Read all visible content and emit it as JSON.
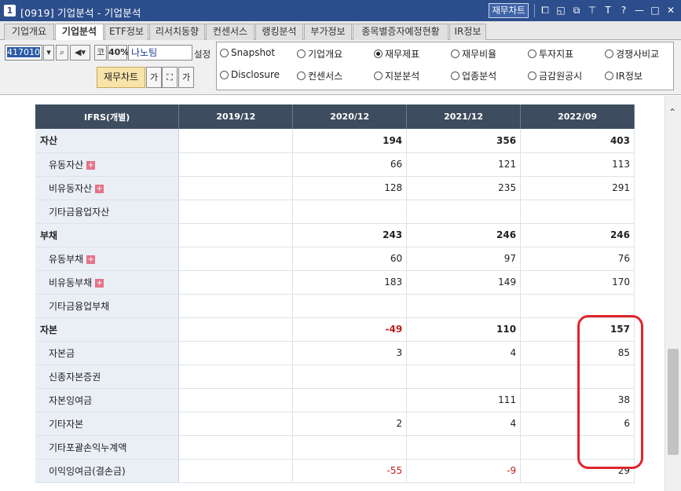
{
  "window": {
    "number": "1",
    "title": "[0919] 기업분석 - 기업분석",
    "financial_chart_button": "재무차트",
    "icons": [
      "chart-icon",
      "window-icon",
      "restore-icon",
      "pin-icon",
      "font-icon",
      "help-icon",
      "minimize-icon",
      "maximize-icon",
      "close-icon"
    ],
    "icon_glyphs": [
      "⧠",
      "◱",
      "⧉",
      "⊤",
      "T",
      "?",
      "—",
      "□",
      "✕"
    ]
  },
  "tabs": [
    {
      "label": "기업개요",
      "active": false
    },
    {
      "label": "기업분석",
      "active": true
    },
    {
      "label": "ETF정보",
      "active": false
    },
    {
      "label": "리서치동향",
      "active": false
    },
    {
      "label": "컨센서스",
      "active": false
    },
    {
      "label": "랭킹분석",
      "active": false
    },
    {
      "label": "부가정보",
      "active": false
    },
    {
      "label": "종목별증자예정현황",
      "active": false
    },
    {
      "label": "IR정보",
      "active": false
    }
  ],
  "toolbar": {
    "stock_code": "417010",
    "code_label": "코",
    "ratio": "40%",
    "company_name": "나노팀",
    "settings_label": "설정",
    "fin_chart_label": "재무차트",
    "font_btn_1": "가",
    "font_btn_2": "가"
  },
  "report_options": [
    {
      "label": "Snapshot",
      "selected": false
    },
    {
      "label": "기업개요",
      "selected": false
    },
    {
      "label": "재무제표",
      "selected": true
    },
    {
      "label": "재무비율",
      "selected": false
    },
    {
      "label": "투자지표",
      "selected": false
    },
    {
      "label": "경쟁사비교",
      "selected": false
    },
    {
      "label": "Disclosure",
      "selected": false
    },
    {
      "label": "컨센서스",
      "selected": false
    },
    {
      "label": "지분분석",
      "selected": false
    },
    {
      "label": "업종분석",
      "selected": false
    },
    {
      "label": "금감원공시",
      "selected": false
    },
    {
      "label": "IR정보",
      "selected": false
    }
  ],
  "table": {
    "headers": [
      "IFRS(개별)",
      "2019/12",
      "2020/12",
      "2021/12",
      "2022/09"
    ],
    "rows": [
      {
        "label": "자산",
        "level": "main",
        "expand": false,
        "values": [
          "",
          "194",
          "356",
          "403"
        ]
      },
      {
        "label": "유동자산",
        "level": "sub",
        "expand": true,
        "values": [
          "",
          "66",
          "121",
          "113"
        ]
      },
      {
        "label": "비유동자산",
        "level": "sub",
        "expand": true,
        "values": [
          "",
          "128",
          "235",
          "291"
        ]
      },
      {
        "label": "기타금융업자산",
        "level": "sub",
        "expand": false,
        "values": [
          "",
          "",
          "",
          ""
        ]
      },
      {
        "label": "부채",
        "level": "main",
        "expand": false,
        "values": [
          "",
          "243",
          "246",
          "246"
        ]
      },
      {
        "label": "유동부채",
        "level": "sub",
        "expand": true,
        "values": [
          "",
          "60",
          "97",
          "76"
        ]
      },
      {
        "label": "비유동부채",
        "level": "sub",
        "expand": true,
        "values": [
          "",
          "183",
          "149",
          "170"
        ]
      },
      {
        "label": "기타금융업부채",
        "level": "sub",
        "expand": false,
        "values": [
          "",
          "",
          "",
          ""
        ]
      },
      {
        "label": "자본",
        "level": "main",
        "expand": false,
        "values": [
          "",
          "-49",
          "110",
          "157"
        ]
      },
      {
        "label": "자본금",
        "level": "sub",
        "expand": false,
        "values": [
          "",
          "3",
          "4",
          "85"
        ]
      },
      {
        "label": "신종자본증권",
        "level": "sub",
        "expand": false,
        "values": [
          "",
          "",
          "",
          ""
        ]
      },
      {
        "label": "자본잉여금",
        "level": "sub",
        "expand": false,
        "values": [
          "",
          "",
          "111",
          "38"
        ]
      },
      {
        "label": "기타자본",
        "level": "sub",
        "expand": false,
        "values": [
          "",
          "2",
          "4",
          "6"
        ]
      },
      {
        "label": "기타포괄손익누계액",
        "level": "sub",
        "expand": false,
        "values": [
          "",
          "",
          "",
          ""
        ]
      },
      {
        "label": "이익잉여금(결손금)",
        "level": "sub",
        "expand": false,
        "values": [
          "",
          "-55",
          "-9",
          "29"
        ]
      }
    ]
  },
  "colors": {
    "titlebar": "#2d4e8c",
    "table_header": "#3d4c5e",
    "label_column": "#eaeff6",
    "negative": "#c0201f",
    "annotation": "#e0242c",
    "expand_badge": "#e5738a"
  }
}
